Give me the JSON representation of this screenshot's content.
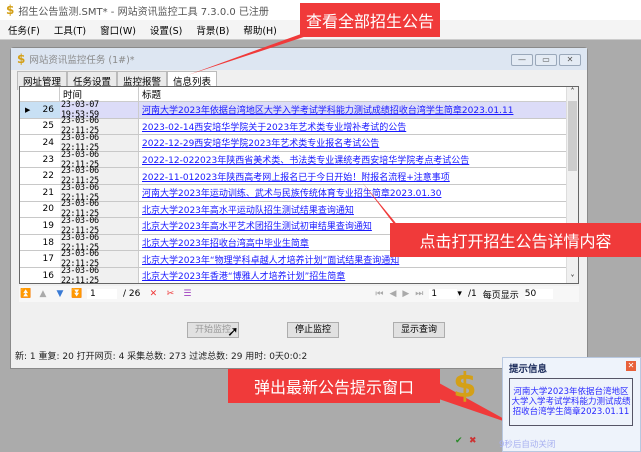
{
  "app": {
    "title": "招生公告监测.SMT* - 网站资讯监控工具 7.3.0.0 已注册"
  },
  "menu": [
    "任务(F)",
    "工具(T)",
    "窗口(W)",
    "设置(S)",
    "背景(B)",
    "帮助(H)"
  ],
  "child": {
    "title": "网站资讯监控任务 (1#)*",
    "tabs": [
      "网址管理",
      "任务设置",
      "监控报警",
      "信息列表"
    ],
    "active_tab": 3
  },
  "grid": {
    "headers": [
      "",
      "时间",
      "标题"
    ],
    "rows": [
      {
        "id": "26",
        "time": "23-03-07 19:53:59",
        "title": "河南大学2023年依据台湾地区大学入学考试学科能力测试成绩招收台湾学生简章2023.01.11",
        "selected": true
      },
      {
        "id": "25",
        "time": "23-03-06 22:11:25",
        "title": "2023-02-14西安培华学院关于2023年艺术类专业增补考试的公告"
      },
      {
        "id": "24",
        "time": "23-03-06 22:11:25",
        "title": "2022-12-29西安培华学院2023年艺术类专业报名考试公告"
      },
      {
        "id": "23",
        "time": "23-03-06 22:11:25",
        "title": "2022-12-022023年陕西省美术类、书法类专业课统考西安培华学院考点考试公告"
      },
      {
        "id": "22",
        "time": "23-03-06 22:11:25",
        "title": "2022-11-012023年陕西高考网上报名已于今日开始！附报名流程+注意事项"
      },
      {
        "id": "21",
        "time": "23-03-06 22:11:25",
        "title": "河南大学2023年运动训练、武术与民族传统体育专业招生简章2023.01.30"
      },
      {
        "id": "20",
        "time": "23-03-06 22:11:25",
        "title": "北京大学2023年高水平运动队招生测试结果查询通知"
      },
      {
        "id": "19",
        "time": "23-03-06 22:11:25",
        "title": "北京大学2023年高水平艺术团招生测试初审结果查询通知"
      },
      {
        "id": "18",
        "time": "23-03-06 22:11:25",
        "title": "北京大学2023年招收台湾高中毕业生简章"
      },
      {
        "id": "17",
        "time": "23-03-06 22:11:25",
        "title": "北京大学2023年“物理学科卓越人才培养计划”面试结果查询通知"
      },
      {
        "id": "16",
        "time": "23-03-06 22:11:25",
        "title": "北京大学2023年香港“博雅人才培养计划”招生简章"
      }
    ]
  },
  "nav": {
    "record": "1",
    "record_total": "/ 26",
    "page": "1",
    "page_total": "/1",
    "per_page_label": "每页显示",
    "per_page": "50"
  },
  "buttons": {
    "start": "开始监控",
    "stop": "停止监控",
    "show": "显示查询"
  },
  "status": "新: 1  重复: 20  打开网页: 4  采集总数: 273  过滤总数: 29  用时: 0天0:0:2",
  "annotations": {
    "a1": "查看全部招生公告",
    "a2": "点击打开招生公告详情内容",
    "a3": "弹出最新公告提示窗口"
  },
  "popup": {
    "title": "提示信息",
    "message": "河南大学2023年依据台湾地区大学入学考试学科能力测试成绩招收台湾学生简章2023.01.11",
    "countdown": "9秒后自动关闭"
  },
  "colors": {
    "annotation": "#f03a3a",
    "link": "#1a1aff"
  }
}
